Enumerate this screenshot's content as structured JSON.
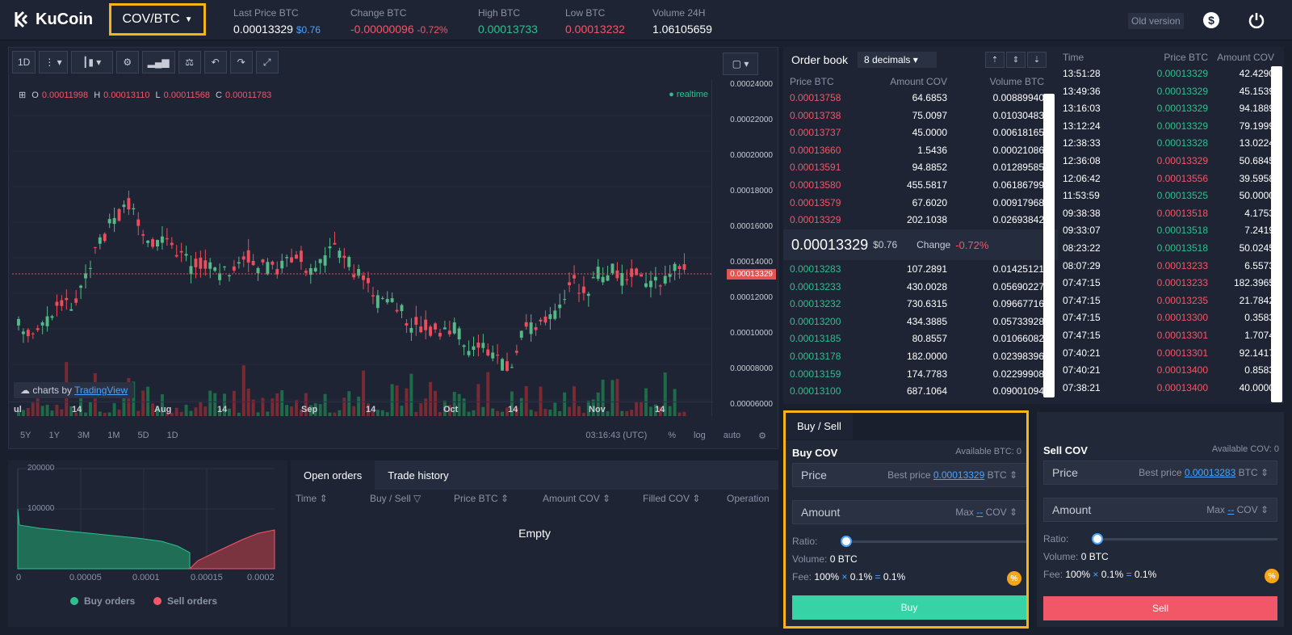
{
  "header": {
    "logo_text": "KuCoin",
    "pair": "COV/BTC",
    "stats": [
      {
        "label": "Last Price BTC",
        "value": "0.00013329",
        "sub": "$0.76",
        "color": "white"
      },
      {
        "label": "Change BTC",
        "value": "-0.00000096",
        "sub": "-0.72%",
        "color": "red"
      },
      {
        "label": "High BTC",
        "value": "0.00013733",
        "sub": "",
        "color": "green"
      },
      {
        "label": "Low BTC",
        "value": "0.00013232",
        "sub": "",
        "color": "red"
      },
      {
        "label": "Volume 24H",
        "value": "1.06105659",
        "sub": "",
        "color": "white"
      }
    ],
    "old_version": "Old version",
    "icons": [
      "dollar-icon",
      "power-icon"
    ]
  },
  "chart": {
    "interval": "1D",
    "ohlc": {
      "o": "0.00011998",
      "h": "0.00013110",
      "l": "0.00011568",
      "c": "0.00011783"
    },
    "realtime_label": "realtime",
    "y_labels": [
      "0.00024000",
      "0.00022000",
      "0.00020000",
      "0.00018000",
      "0.00016000",
      "0.00014000",
      "0.00012000",
      "0.00010000",
      "0.00008000",
      "0.00006000"
    ],
    "current_price_tag": "0.00013329",
    "x_labels": [
      "ul",
      "14",
      "Aug",
      "14",
      "Sep",
      "14",
      "Oct",
      "14",
      "Nov",
      "14"
    ],
    "ranges": [
      "5Y",
      "1Y",
      "3M",
      "1M",
      "5D",
      "1D"
    ],
    "clock": "03:16:43 (UTC)",
    "scale_opts": [
      "%",
      "log",
      "auto"
    ],
    "tv_prefix": "charts by",
    "tv_name": "TradingView"
  },
  "orderbook": {
    "title": "Order book",
    "decimals": "8 decimals",
    "cols": [
      "Price BTC",
      "Amount COV",
      "Volume BTC"
    ],
    "asks": [
      [
        "0.00013758",
        "64.6853",
        "0.00889940"
      ],
      [
        "0.00013738",
        "75.0097",
        "0.01030483"
      ],
      [
        "0.00013737",
        "45.0000",
        "0.00618165"
      ],
      [
        "0.00013660",
        "1.5436",
        "0.00021086"
      ],
      [
        "0.00013591",
        "94.8852",
        "0.01289585"
      ],
      [
        "0.00013580",
        "455.5817",
        "0.06186799"
      ],
      [
        "0.00013579",
        "67.6020",
        "0.00917968"
      ],
      [
        "0.00013329",
        "202.1038",
        "0.02693842"
      ]
    ],
    "mid_price": "0.00013329",
    "mid_usd": "$0.76",
    "mid_change_label": "Change",
    "mid_change": "-0.72%",
    "bids": [
      [
        "0.00013283",
        "107.2891",
        "0.01425121"
      ],
      [
        "0.00013233",
        "430.0028",
        "0.05690227"
      ],
      [
        "0.00013232",
        "730.6315",
        "0.09667716"
      ],
      [
        "0.00013200",
        "434.3885",
        "0.05733928"
      ],
      [
        "0.00013185",
        "80.8557",
        "0.01066082"
      ],
      [
        "0.00013178",
        "182.0000",
        "0.02398396"
      ],
      [
        "0.00013159",
        "174.7783",
        "0.02299908"
      ],
      [
        "0.00013100",
        "687.1064",
        "0.09001094"
      ]
    ]
  },
  "trade_history": {
    "cols": [
      "Time",
      "Price BTC",
      "Amount COV"
    ],
    "rows": [
      [
        "13:51:28",
        "0.00013329",
        "42.4290",
        "g"
      ],
      [
        "13:49:36",
        "0.00013329",
        "45.1539",
        "g"
      ],
      [
        "13:16:03",
        "0.00013329",
        "94.1889",
        "g"
      ],
      [
        "13:12:24",
        "0.00013329",
        "79.1999",
        "g"
      ],
      [
        "12:38:33",
        "0.00013328",
        "13.0224",
        "g"
      ],
      [
        "12:36:08",
        "0.00013329",
        "50.6845",
        "r"
      ],
      [
        "12:06:42",
        "0.00013556",
        "39.5958",
        "r"
      ],
      [
        "11:53:59",
        "0.00013525",
        "50.0000",
        "g"
      ],
      [
        "09:38:38",
        "0.00013518",
        "4.1753",
        "r"
      ],
      [
        "09:33:07",
        "0.00013518",
        "7.2419",
        "g"
      ],
      [
        "08:23:22",
        "0.00013518",
        "50.0245",
        "g"
      ],
      [
        "08:07:29",
        "0.00013233",
        "6.5573",
        "r"
      ],
      [
        "07:47:15",
        "0.00013233",
        "182.3965",
        "r"
      ],
      [
        "07:47:15",
        "0.00013235",
        "21.7842",
        "r"
      ],
      [
        "07:47:15",
        "0.00013300",
        "0.3583",
        "r"
      ],
      [
        "07:47:15",
        "0.00013301",
        "1.7074",
        "r"
      ],
      [
        "07:40:21",
        "0.00013301",
        "92.1417",
        "r"
      ],
      [
        "07:40:21",
        "0.00013400",
        "0.8583",
        "r"
      ],
      [
        "07:38:21",
        "0.00013400",
        "40.0000",
        "r"
      ]
    ]
  },
  "depth": {
    "y_labels": [
      "200000",
      "100000"
    ],
    "x_labels": [
      "0",
      "0.00005",
      "0.0001",
      "0.00015",
      "0.0002"
    ],
    "legend_buy": "Buy orders",
    "legend_sell": "Sell orders"
  },
  "orders": {
    "tabs": [
      "Open orders",
      "Trade history"
    ],
    "cols": [
      "Time",
      "Buy / Sell",
      "Price BTC",
      "Amount COV",
      "Filled COV",
      "Operation"
    ],
    "empty": "Empty"
  },
  "buy": {
    "tab": "Buy / Sell",
    "title": "Buy COV",
    "available": "Available BTC: 0",
    "price_placeholder": "Price",
    "best_label": "Best price",
    "best_price": "0.00013329",
    "unit": "BTC",
    "amount_placeholder": "Amount",
    "max_label": "Max",
    "max_val": "--",
    "amount_unit": "COV",
    "ratio_label": "Ratio:",
    "ratio": 0,
    "volume_label": "Volume:",
    "volume": "0 BTC",
    "fee_label": "Fee:",
    "fee": [
      "100%",
      "×",
      "0.1%",
      "=",
      "0.1%"
    ],
    "button": "Buy"
  },
  "sell": {
    "title": "Sell COV",
    "available": "Available COV: 0",
    "price_placeholder": "Price",
    "best_label": "Best price",
    "best_price": "0.00013283",
    "unit": "BTC",
    "amount_placeholder": "Amount",
    "max_label": "Max",
    "max_val": "--",
    "amount_unit": "COV",
    "ratio_label": "Ratio:",
    "ratio": 0,
    "volume_label": "Volume:",
    "volume": "0 BTC",
    "fee_label": "Fee:",
    "fee": [
      "100%",
      "×",
      "0.1%",
      "=",
      "0.1%"
    ],
    "button": "Sell"
  }
}
